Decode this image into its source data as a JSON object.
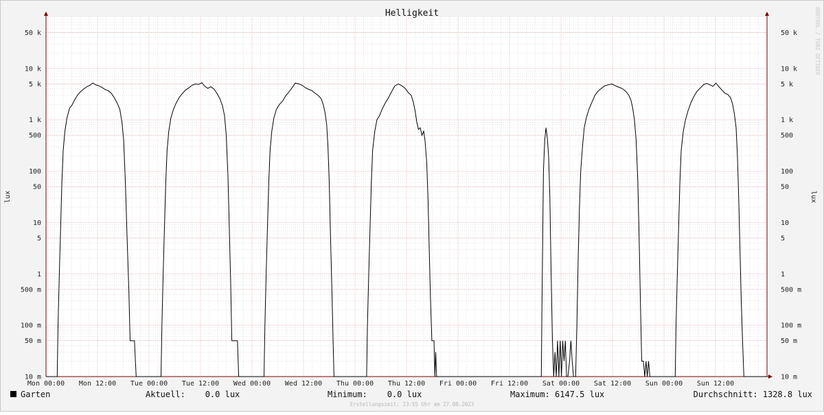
{
  "chart_data": {
    "type": "line",
    "title": "Helligkeit",
    "ylabel": "lux",
    "yscale": "log",
    "ylim": [
      0.01,
      100000
    ],
    "xlim": [
      0,
      168
    ],
    "x_unit": "hours",
    "grid": true,
    "y_ticks": [
      {
        "value": 0.01,
        "label": "10 m"
      },
      {
        "value": 0.05,
        "label": "50 m"
      },
      {
        "value": 0.1,
        "label": "100 m"
      },
      {
        "value": 0.5,
        "label": "500 m"
      },
      {
        "value": 1,
        "label": "1"
      },
      {
        "value": 5,
        "label": "5"
      },
      {
        "value": 10,
        "label": "10"
      },
      {
        "value": 50,
        "label": "50"
      },
      {
        "value": 100,
        "label": "100"
      },
      {
        "value": 500,
        "label": "500"
      },
      {
        "value": 1000,
        "label": "1 k"
      },
      {
        "value": 5000,
        "label": "5 k"
      },
      {
        "value": 10000,
        "label": "10 k"
      },
      {
        "value": 50000,
        "label": "50 k"
      }
    ],
    "x_ticks": [
      {
        "value": 0,
        "label": "Mon 00:00"
      },
      {
        "value": 12,
        "label": "Mon 12:00"
      },
      {
        "value": 24,
        "label": "Tue 00:00"
      },
      {
        "value": 36,
        "label": "Tue 12:00"
      },
      {
        "value": 48,
        "label": "Wed 00:00"
      },
      {
        "value": 60,
        "label": "Wed 12:00"
      },
      {
        "value": 72,
        "label": "Thu 00:00"
      },
      {
        "value": 84,
        "label": "Thu 12:00"
      },
      {
        "value": 96,
        "label": "Fri 00:00"
      },
      {
        "value": 108,
        "label": "Fri 12:00"
      },
      {
        "value": 120,
        "label": "Sat 00:00"
      },
      {
        "value": 132,
        "label": "Sat 12:00"
      },
      {
        "value": 144,
        "label": "Sun 00:00"
      },
      {
        "value": 156,
        "label": "Sun 12:00"
      }
    ],
    "series": [
      {
        "name": "Garten",
        "color": "#000000",
        "points": [
          [
            0,
            0.01
          ],
          [
            2.6,
            0.01
          ],
          [
            2.8,
            0.1
          ],
          [
            3.1,
            1
          ],
          [
            3.4,
            8
          ],
          [
            3.7,
            60
          ],
          [
            4,
            250
          ],
          [
            4.4,
            600
          ],
          [
            4.9,
            1100
          ],
          [
            5.5,
            1700
          ],
          [
            6,
            1900
          ],
          [
            6.6,
            2400
          ],
          [
            7.3,
            3000
          ],
          [
            8,
            3500
          ],
          [
            8.8,
            4000
          ],
          [
            9.5,
            4400
          ],
          [
            10.2,
            4700
          ],
          [
            10.9,
            5200
          ],
          [
            11.6,
            4800
          ],
          [
            12.3,
            4600
          ],
          [
            13,
            4300
          ],
          [
            13.8,
            3900
          ],
          [
            14.5,
            3700
          ],
          [
            15.2,
            3300
          ],
          [
            15.9,
            2700
          ],
          [
            16.6,
            2100
          ],
          [
            17.2,
            1600
          ],
          [
            17.7,
            900
          ],
          [
            18.1,
            400
          ],
          [
            18.5,
            60
          ],
          [
            18.9,
            5
          ],
          [
            19.3,
            0.5
          ],
          [
            19.6,
            0.05
          ],
          [
            20.6,
            0.05
          ],
          [
            21,
            0.01
          ],
          [
            26.8,
            0.01
          ],
          [
            27,
            0.1
          ],
          [
            27.3,
            1
          ],
          [
            27.6,
            8
          ],
          [
            27.9,
            60
          ],
          [
            28.2,
            250
          ],
          [
            28.6,
            600
          ],
          [
            29.1,
            1100
          ],
          [
            29.7,
            1600
          ],
          [
            30.3,
            2100
          ],
          [
            31,
            2700
          ],
          [
            31.7,
            3200
          ],
          [
            32.5,
            3800
          ],
          [
            33.3,
            4200
          ],
          [
            34,
            4700
          ],
          [
            34.8,
            5000
          ],
          [
            35.6,
            4900
          ],
          [
            36.3,
            5300
          ],
          [
            37,
            4500
          ],
          [
            37.7,
            4100
          ],
          [
            38.4,
            4400
          ],
          [
            39.1,
            4000
          ],
          [
            39.8,
            3300
          ],
          [
            40.5,
            2600
          ],
          [
            41.1,
            1900
          ],
          [
            41.6,
            1200
          ],
          [
            42,
            500
          ],
          [
            42.4,
            80
          ],
          [
            42.7,
            8
          ],
          [
            43,
            0.8
          ],
          [
            43.3,
            0.05
          ],
          [
            44.6,
            0.05
          ],
          [
            44.9,
            0.01
          ],
          [
            50.8,
            0.01
          ],
          [
            51,
            0.1
          ],
          [
            51.3,
            1
          ],
          [
            51.6,
            8
          ],
          [
            51.9,
            60
          ],
          [
            52.2,
            250
          ],
          [
            52.6,
            600
          ],
          [
            53.1,
            1100
          ],
          [
            53.7,
            1600
          ],
          [
            54.4,
            2000
          ],
          [
            55.1,
            2300
          ],
          [
            55.8,
            2900
          ],
          [
            56.6,
            3500
          ],
          [
            57.4,
            4300
          ],
          [
            58.1,
            5200
          ],
          [
            58.9,
            5000
          ],
          [
            59.7,
            4700
          ],
          [
            60.5,
            4200
          ],
          [
            61.3,
            3900
          ],
          [
            62,
            3700
          ],
          [
            62.7,
            3300
          ],
          [
            63.4,
            3000
          ],
          [
            64.1,
            2600
          ],
          [
            64.6,
            2000
          ],
          [
            65,
            1400
          ],
          [
            65.4,
            800
          ],
          [
            65.7,
            300
          ],
          [
            66,
            60
          ],
          [
            66.3,
            5
          ],
          [
            66.6,
            0.5
          ],
          [
            66.9,
            0.05
          ],
          [
            67.1,
            0.01
          ],
          [
            74.7,
            0.01
          ],
          [
            74.9,
            0.1
          ],
          [
            75.2,
            1
          ],
          [
            75.5,
            8
          ],
          [
            75.8,
            60
          ],
          [
            76.1,
            250
          ],
          [
            76.6,
            600
          ],
          [
            77.1,
            1000
          ],
          [
            77.7,
            1200
          ],
          [
            78.3,
            1600
          ],
          [
            79,
            2100
          ],
          [
            79.7,
            2600
          ],
          [
            80.5,
            3500
          ],
          [
            81.3,
            4600
          ],
          [
            82.1,
            5000
          ],
          [
            82.9,
            4600
          ],
          [
            83.7,
            4100
          ],
          [
            84.4,
            3400
          ],
          [
            85.1,
            3000
          ],
          [
            85.6,
            2200
          ],
          [
            86,
            1500
          ],
          [
            86.4,
            900
          ],
          [
            86.8,
            650
          ],
          [
            87.2,
            700
          ],
          [
            87.6,
            500
          ],
          [
            88,
            600
          ],
          [
            88.3,
            400
          ],
          [
            88.7,
            150
          ],
          [
            89,
            30
          ],
          [
            89.3,
            3
          ],
          [
            89.6,
            0.3
          ],
          [
            89.9,
            0.05
          ],
          [
            90.4,
            0.05
          ],
          [
            90.6,
            0.01
          ],
          [
            90.8,
            0.03
          ],
          [
            91,
            0.01
          ],
          [
            115.4,
            0.01
          ],
          [
            115.6,
            0.5
          ],
          [
            115.9,
            100
          ],
          [
            116.2,
            400
          ],
          [
            116.5,
            700
          ],
          [
            116.8,
            450
          ],
          [
            117.1,
            200
          ],
          [
            117.4,
            30
          ],
          [
            117.7,
            1
          ],
          [
            118,
            0.05
          ],
          [
            118.3,
            0.01
          ],
          [
            118.6,
            0.03
          ],
          [
            118.9,
            0.01
          ],
          [
            119.2,
            0.05
          ],
          [
            119.5,
            0.01
          ],
          [
            119.8,
            0.05
          ],
          [
            120.1,
            0.01
          ],
          [
            120.4,
            0.05
          ],
          [
            120.7,
            0.02
          ],
          [
            121,
            0.05
          ],
          [
            121.3,
            0.01
          ],
          [
            121.6,
            0.01
          ],
          [
            122,
            0.02
          ],
          [
            122.3,
            0.05
          ],
          [
            122.6,
            0.02
          ],
          [
            122.9,
            0.01
          ],
          [
            123.4,
            0.01
          ],
          [
            123.7,
            0.1
          ],
          [
            124,
            2
          ],
          [
            124.3,
            20
          ],
          [
            124.6,
            100
          ],
          [
            125,
            300
          ],
          [
            125.4,
            700
          ],
          [
            125.9,
            1100
          ],
          [
            126.5,
            1600
          ],
          [
            127.2,
            2200
          ],
          [
            127.9,
            3000
          ],
          [
            128.6,
            3600
          ],
          [
            129.4,
            4100
          ],
          [
            130.2,
            4600
          ],
          [
            131,
            4800
          ],
          [
            131.8,
            5000
          ],
          [
            132.5,
            4700
          ],
          [
            133.2,
            4400
          ],
          [
            133.9,
            4200
          ],
          [
            134.6,
            3900
          ],
          [
            135.2,
            3500
          ],
          [
            135.8,
            3000
          ],
          [
            136.3,
            2400
          ],
          [
            136.7,
            1700
          ],
          [
            137.1,
            1000
          ],
          [
            137.5,
            400
          ],
          [
            137.9,
            60
          ],
          [
            138.2,
            5
          ],
          [
            138.5,
            0.3
          ],
          [
            138.8,
            0.02
          ],
          [
            139.2,
            0.02
          ],
          [
            139.5,
            0.01
          ],
          [
            139.8,
            0.02
          ],
          [
            140.1,
            0.01
          ],
          [
            140.4,
            0.02
          ],
          [
            140.7,
            0.01
          ],
          [
            146.6,
            0.01
          ],
          [
            146.8,
            0.1
          ],
          [
            147.1,
            1
          ],
          [
            147.4,
            8
          ],
          [
            147.7,
            60
          ],
          [
            148,
            250
          ],
          [
            148.5,
            600
          ],
          [
            149,
            1000
          ],
          [
            149.6,
            1500
          ],
          [
            150.3,
            2200
          ],
          [
            151,
            2900
          ],
          [
            151.7,
            3600
          ],
          [
            152.5,
            4200
          ],
          [
            153.3,
            4900
          ],
          [
            154,
            5100
          ],
          [
            154.7,
            4800
          ],
          [
            155.4,
            4500
          ],
          [
            156.1,
            5200
          ],
          [
            156.8,
            4400
          ],
          [
            157.5,
            3800
          ],
          [
            158.2,
            3300
          ],
          [
            158.9,
            3100
          ],
          [
            159.5,
            2700
          ],
          [
            160,
            2000
          ],
          [
            160.4,
            1300
          ],
          [
            160.8,
            700
          ],
          [
            161.1,
            200
          ],
          [
            161.4,
            30
          ],
          [
            161.7,
            3
          ],
          [
            162,
            0.3
          ],
          [
            162.3,
            0.05
          ],
          [
            162.6,
            0.01
          ],
          [
            168,
            0.01
          ]
        ]
      }
    ]
  },
  "legend": {
    "series_name": "Garten",
    "aktuell": "Aktuell:    0.0 lux",
    "minimum": "Minimum:    0.0 lux",
    "maximum": "Maximum: 6147.5 lux",
    "durchschnitt": "Durchschnitt: 1328.8 lux"
  },
  "credit": "RRDTOOL / TOBI OETIKER",
  "created": "Erstellungszeit: 23:55 Uhr am 27.08.2023",
  "colors": {
    "background": "#f3f3f3",
    "canvas": "#ffffff",
    "major_grid": "#e8a6a6",
    "minor_grid": "#d0d0d0",
    "axis": "#7a0000",
    "line": "#000000"
  }
}
